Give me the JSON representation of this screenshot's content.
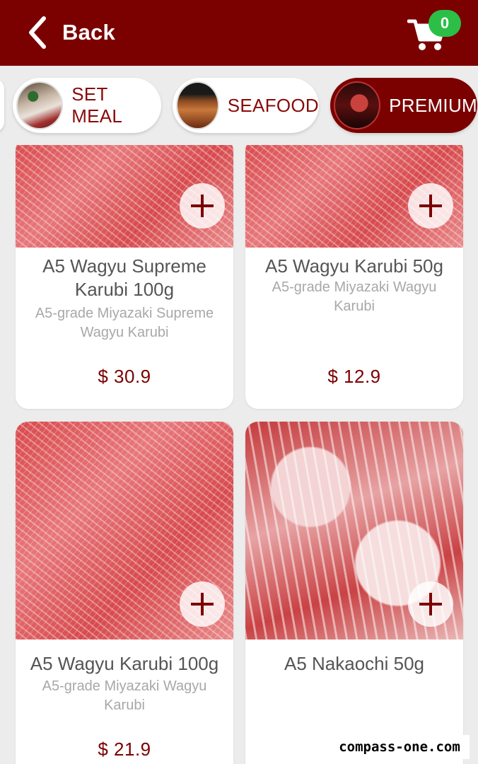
{
  "header": {
    "back_label": "Back",
    "cart_count": "0",
    "bg_color": "#7b0000",
    "badge_color": "#2bbf47"
  },
  "categories": [
    {
      "label": "SET MEAL",
      "icon": "set-meal-thumbnail",
      "active": false
    },
    {
      "label": "SEAFOOD",
      "icon": "seafood-thumbnail",
      "active": false
    },
    {
      "label": "PREMIUM",
      "icon": "premium-thumbnail",
      "active": true
    }
  ],
  "products": [
    {
      "name": "A5 Wagyu Supreme Karubi 100g",
      "description": "A5-grade Miyazaki Supreme Wagyu Karubi",
      "price": "$ 30.9"
    },
    {
      "name": "A5 Wagyu Karubi 50g",
      "description": "A5-grade Miyazaki Wagyu Karubi",
      "price": "$ 12.9"
    },
    {
      "name": "A5 Wagyu Karubi 100g",
      "description": "A5-grade Miyazaki Wagyu Karubi",
      "price": "$ 21.9"
    },
    {
      "name": "A5 Nakaochi 50g",
      "description": "",
      "price": ""
    }
  ],
  "watermark": "compass-one.com"
}
